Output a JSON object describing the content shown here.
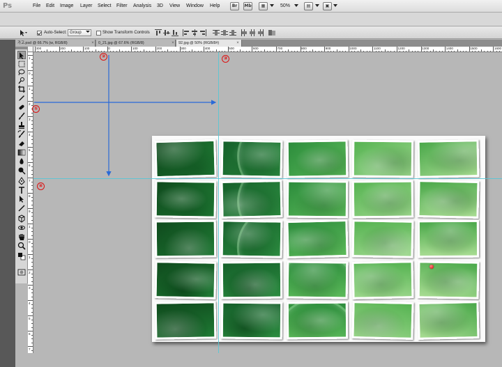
{
  "app": {
    "logo": "Ps"
  },
  "menu": [
    "File",
    "Edit",
    "Image",
    "Layer",
    "Select",
    "Filter",
    "Analysis",
    "3D",
    "View",
    "Window",
    "Help"
  ],
  "app_bar": {
    "zoom": "50%"
  },
  "options": {
    "auto_select_label": "Auto-Select:",
    "auto_select_checked": true,
    "auto_select_value": "Group",
    "show_transform_label": "Show Transform Controls",
    "show_transform_checked": false
  },
  "tabs": [
    {
      "label": "가고.psd @ 66.7% (w, RGB/8)",
      "close": "×",
      "active": false
    },
    {
      "label": "0_21.jpg @ 67.6% (RGB/8)",
      "close": "×",
      "active": false
    },
    {
      "label": "92.jpg @ 50% (RGB/8#)",
      "close": "×",
      "active": true
    }
  ],
  "ruler_top_labels": [
    "300",
    "200",
    "100",
    "0",
    "100",
    "200",
    "300",
    "400",
    "500",
    "600",
    "700",
    "800",
    "900",
    "1000",
    "1100",
    "1200",
    "1300",
    "1400",
    "1500",
    "1600"
  ],
  "ruler_left_labels": [
    "1",
    "0",
    "1",
    "2",
    "3",
    "4",
    "5",
    "6",
    "7",
    "8",
    "9",
    "1",
    "0",
    "1",
    "2",
    "3",
    "4",
    "5",
    "6",
    "7"
  ],
  "annotations": {
    "m1": "①",
    "m2": "②",
    "m3": "③",
    "m4": "④"
  },
  "tools": [
    "move-icon",
    "marquee-icon",
    "lasso-icon",
    "quick-select-icon",
    "crop-icon",
    "eyedropper-icon",
    "healing-icon",
    "brush-icon",
    "clone-stamp-icon",
    "history-brush-icon",
    "eraser-icon",
    "gradient-icon",
    "blur-icon",
    "dodge-icon",
    "pen-icon",
    "type-icon",
    "path-select-icon",
    "shape-icon",
    "3d-rotate-icon",
    "3d-orbit-icon",
    "hand-icon",
    "zoom-icon",
    "color-swatches-icon",
    "quick-mask-icon"
  ],
  "colors": {
    "guide": "#57c6d6",
    "arrow": "#2a6ad8",
    "annotation": "#d11111"
  }
}
